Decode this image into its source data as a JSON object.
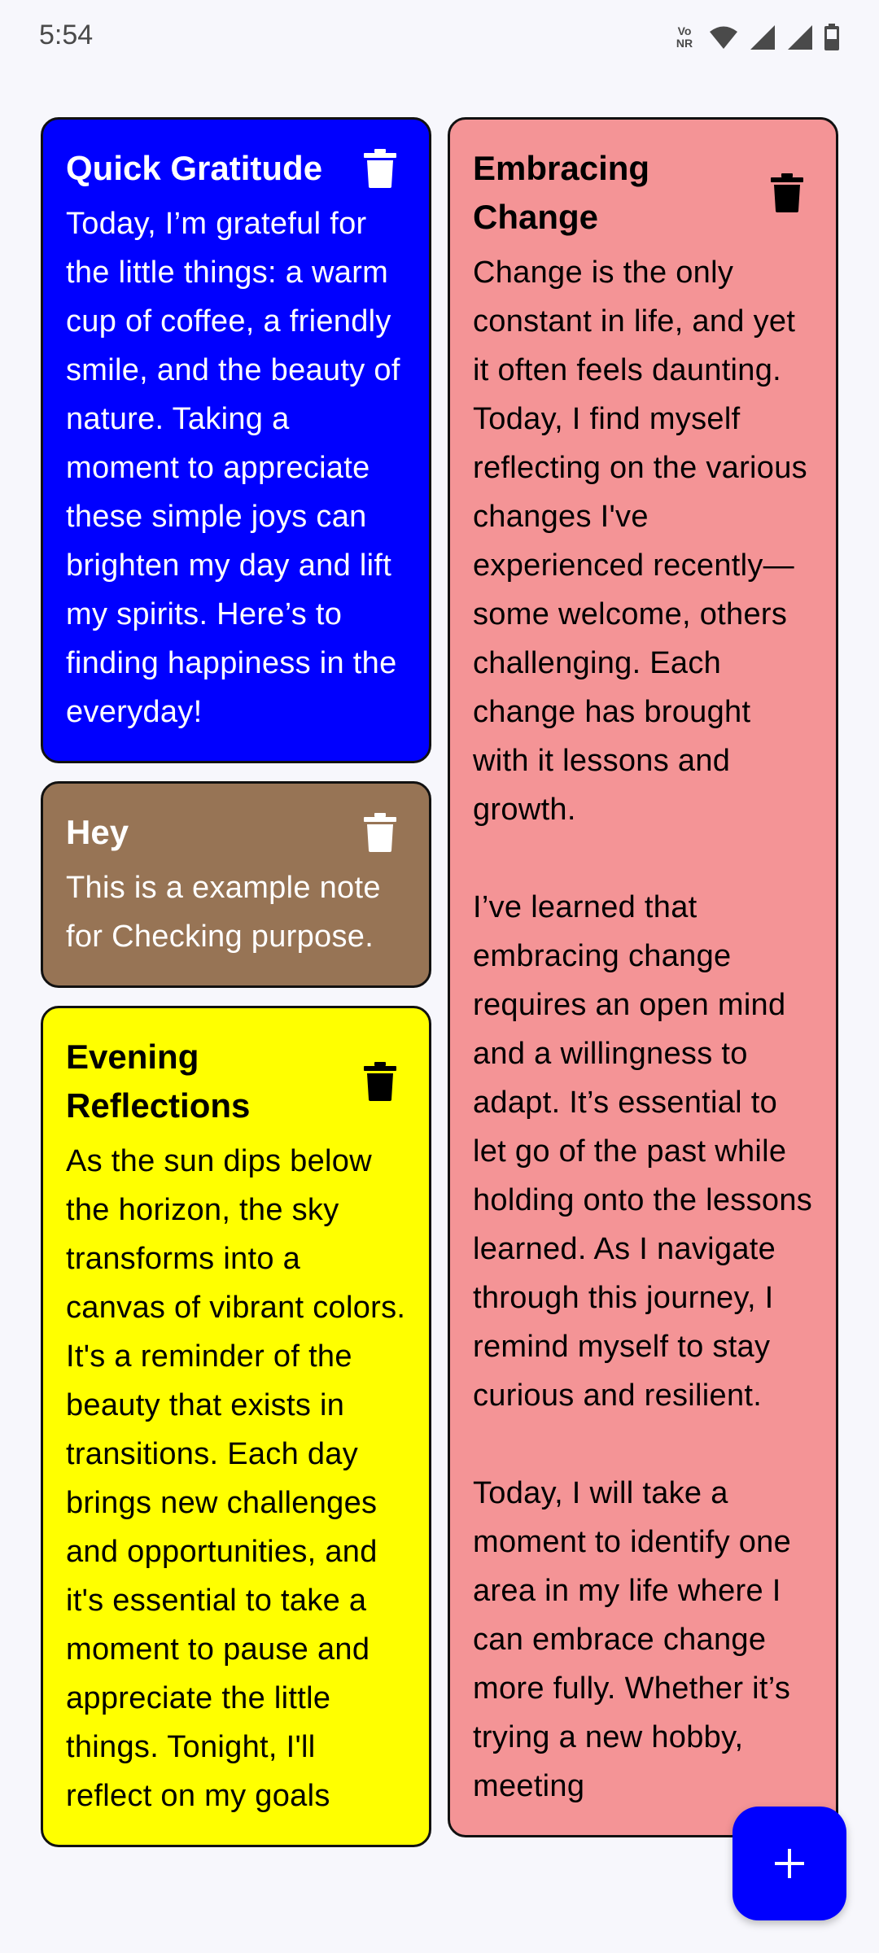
{
  "status_bar": {
    "time": "5:54",
    "network_label": "Vo NR",
    "icons": [
      "volte-icon",
      "wifi-icon",
      "signal-icon",
      "signal-icon-2",
      "battery-icon"
    ]
  },
  "notes": {
    "quick_gratitude": {
      "title": "Quick Gratitude",
      "body": "Today, I’m grateful for the little things: a warm cup of coffee, a friendly smile, and the beauty of nature. Taking a moment to appreciate these simple joys can brighten my day and lift my spirits. Here’s to finding happiness in the everyday!",
      "color": "#0000ff",
      "text_color": "#ffffff"
    },
    "hey": {
      "title": "Hey",
      "body": "This is a example note for Checking purpose.",
      "color": "#977455",
      "text_color": "#ffffff"
    },
    "evening_reflections": {
      "title": "Evening Reflections",
      "body": "As the sun dips below the horizon, the sky transforms into a canvas of vibrant colors. It's a reminder of the beauty that exists in transitions. Each day brings new challenges and opportunities, and it's essential to take a moment to pause and appreciate the little things. Tonight, I'll reflect on my goals",
      "color": "#ffff00",
      "text_color": "#000000"
    },
    "embracing_change": {
      "title": "Embracing Change",
      "body": "Change is the only constant in life, and yet it often feels daunting. Today, I find myself reflecting on the various changes I've experienced recently—some welcome, others challenging. Each change has brought with it lessons and growth.\n\nI’ve learned that embracing change requires an open mind and a willingness to adapt. It’s essential to let go of the past while holding onto the lessons learned. As I navigate through this journey, I remind myself to stay curious and resilient.\n\nToday, I will take a moment to identify one area in my life where I can embrace change more fully. Whether it’s trying a new hobby, meeting",
      "color": "#f49496",
      "text_color": "#000000"
    }
  },
  "fab": {
    "icon": "plus-icon",
    "color": "#0000ff"
  }
}
